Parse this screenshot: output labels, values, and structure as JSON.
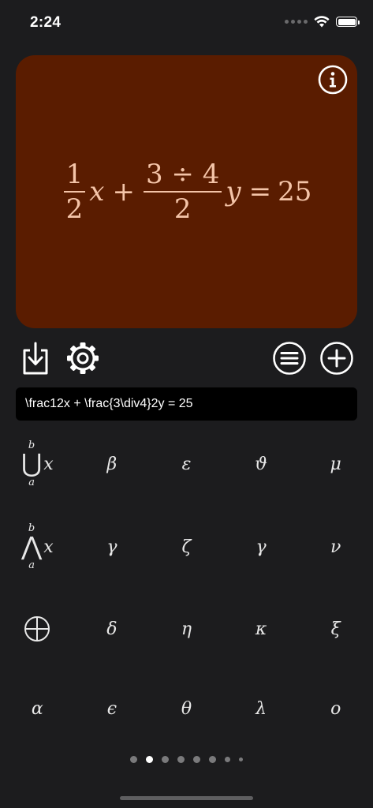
{
  "status_bar": {
    "time": "2:24",
    "icons": [
      "cellular-signal-icon",
      "wifi-icon",
      "battery-icon"
    ]
  },
  "display": {
    "background_color": "#5a1c00",
    "text_color": "#f4c4a8",
    "info_icon": "info-icon",
    "formula": {
      "frac1_num": "1",
      "frac1_den": "2",
      "var1": "x",
      "plus": "+",
      "frac2_num": "3 ÷ 4",
      "frac2_den": "2",
      "var2": "y",
      "equals": "=",
      "rhs": "25"
    }
  },
  "toolbar": {
    "left": [
      "download-icon",
      "gear-icon"
    ],
    "right": [
      "list-icon",
      "plus-icon"
    ]
  },
  "latex_input": {
    "value": "\\frac12x + \\frac{3\\div4}2y = 25"
  },
  "symbols": {
    "row1": {
      "k1": {
        "lower": "a",
        "upper": "b",
        "glyph": "⋃",
        "arg": "x"
      },
      "k2": "β",
      "k3": "ε",
      "k4": "ϑ",
      "k5": "μ"
    },
    "row2": {
      "k1": {
        "lower": "a",
        "upper": "b",
        "glyph": "⋀",
        "arg": "x"
      },
      "k2": "γ",
      "k3": "ζ",
      "k4": "γ",
      "k5": "ν"
    },
    "row3": {
      "k1": "circled-plus-icon",
      "k2": "δ",
      "k3": "η",
      "k4": "κ",
      "k5": "ξ"
    },
    "row4": {
      "k1": "α",
      "k2": "ϵ",
      "k3": "θ",
      "k4": "λ",
      "k5": "o"
    }
  },
  "pagination": {
    "total": 8,
    "current": 2
  }
}
